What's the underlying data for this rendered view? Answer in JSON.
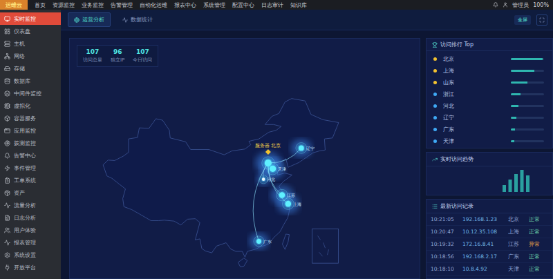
{
  "top_bar": {
    "logo": "运维云",
    "menu": [
      "首页",
      "资源监控",
      "业务监控",
      "告警管理",
      "自动化运维",
      "报表中心",
      "系统管理",
      "配置中心",
      "日志审计",
      "知识库"
    ],
    "user": "管理员",
    "zoom": "100%"
  },
  "sidebar": {
    "items": [
      {
        "label": "实时监控",
        "selected": true
      },
      {
        "label": "仪表盘",
        "selected": false
      },
      {
        "label": "主机",
        "selected": false
      },
      {
        "label": "网络",
        "selected": false
      },
      {
        "label": "存储",
        "selected": false
      },
      {
        "label": "数据库",
        "selected": false
      },
      {
        "label": "中间件监控",
        "selected": false
      },
      {
        "label": "虚拟化",
        "selected": false
      },
      {
        "label": "容器服务",
        "selected": false
      },
      {
        "label": "应用监控",
        "selected": false
      },
      {
        "label": "拨测监控",
        "selected": false
      },
      {
        "label": "告警中心",
        "selected": false
      },
      {
        "label": "事件管理",
        "selected": false
      },
      {
        "label": "工单系统",
        "selected": false
      },
      {
        "label": "资产",
        "selected": false
      },
      {
        "label": "流量分析",
        "selected": false
      },
      {
        "label": "日志分析",
        "selected": false
      },
      {
        "label": "用户体验",
        "selected": false
      },
      {
        "label": "报表管理",
        "selected": false
      },
      {
        "label": "系统设置",
        "selected": false
      },
      {
        "label": "开放平台",
        "selected": false
      }
    ]
  },
  "tabs": [
    {
      "label": "运营分析",
      "selected": true
    },
    {
      "label": "数据统计",
      "selected": false
    }
  ],
  "header_button": "全屏",
  "stats": [
    {
      "value": "107",
      "label": "访问总量"
    },
    {
      "value": "96",
      "label": "独立IP"
    },
    {
      "value": "107",
      "label": "今日访问"
    }
  ],
  "map": {
    "points": [
      {
        "label": "服务器 北京",
        "kind": "server",
        "lng": 116.4,
        "lat": 39.9,
        "level": 0.9
      },
      {
        "label": "辽宁",
        "kind": "city",
        "lng": 125.0,
        "lat": 43.0,
        "level": 0.6
      },
      {
        "label": "天津",
        "kind": "city",
        "lng": 117.6,
        "lat": 38.7,
        "level": 0.8
      },
      {
        "label": "河北",
        "kind": "city",
        "lng": 115.2,
        "lat": 36.5,
        "level": 0.2
      },
      {
        "label": "江苏",
        "kind": "city",
        "lng": 120.0,
        "lat": 33.2,
        "level": 0.7
      },
      {
        "label": "上海",
        "kind": "city",
        "lng": 121.6,
        "lat": 31.4,
        "level": 0.7
      },
      {
        "label": "广东",
        "kind": "city",
        "lng": 114.0,
        "lat": 23.6,
        "level": 0.5
      }
    ]
  },
  "ranking": {
    "title": "访问排行 Top",
    "rows": [
      {
        "name": "北京",
        "level": 0.95,
        "color": "#f2c230"
      },
      {
        "name": "上海",
        "level": 0.7,
        "color": "#f2c230"
      },
      {
        "name": "山东",
        "level": 0.5,
        "color": "#f2c230"
      },
      {
        "name": "浙江",
        "level": 0.3,
        "color": "#3fa9f5"
      },
      {
        "name": "河北",
        "level": 0.22,
        "color": "#3fa9f5"
      },
      {
        "name": "辽宁",
        "level": 0.16,
        "color": "#3fa9f5"
      },
      {
        "name": "广东",
        "level": 0.12,
        "color": "#3fa9f5"
      },
      {
        "name": "天津",
        "level": 0.1,
        "color": "#3fa9f5"
      }
    ]
  },
  "trend": {
    "title": "实时访问趋势",
    "values": [
      5,
      9,
      13,
      16,
      12
    ]
  },
  "records": {
    "title": "最新访问记录",
    "rows": [
      {
        "time": "10:21:05",
        "ip": "192.168.1.23",
        "city": "北京",
        "status": "正常"
      },
      {
        "time": "10:20:47",
        "ip": "10.12.35.108",
        "city": "上海",
        "status": "正常"
      },
      {
        "time": "10:19:32",
        "ip": "172.16.8.41",
        "city": "江苏",
        "status": "异常"
      },
      {
        "time": "10:18:56",
        "ip": "192.168.2.17",
        "city": "广东",
        "status": "正常"
      },
      {
        "time": "10:18:10",
        "ip": "10.8.4.92",
        "city": "天津",
        "status": "正常"
      }
    ]
  }
}
